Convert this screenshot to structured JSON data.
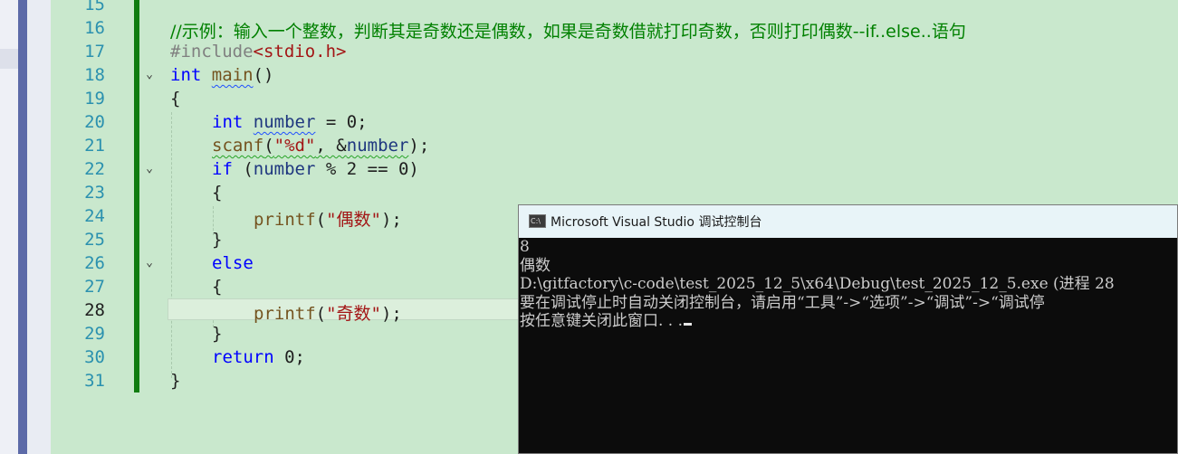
{
  "editor": {
    "lines": [
      {
        "num": "15"
      },
      {
        "num": "16"
      },
      {
        "num": "17"
      },
      {
        "num": "18"
      },
      {
        "num": "19"
      },
      {
        "num": "20"
      },
      {
        "num": "21"
      },
      {
        "num": "22"
      },
      {
        "num": "23"
      },
      {
        "num": "24"
      },
      {
        "num": "25"
      },
      {
        "num": "26"
      },
      {
        "num": "27"
      },
      {
        "num": "28"
      },
      {
        "num": "29"
      },
      {
        "num": "30"
      },
      {
        "num": "31"
      }
    ],
    "code": {
      "comment": "//示例：输入一个整数，判断其是奇数还是偶数，如果是奇数借就打印奇数，否则打印偶数--if..else..语句",
      "include_kw": "#include",
      "include_hdr": "<stdio.h>",
      "int_kw": "int",
      "main_fn": "main",
      "main_parens": "()",
      "open_brace": "{",
      "close_brace": "}",
      "number_var": "number",
      "assign_zero": " = 0;",
      "scanf_fn": "scanf",
      "paren_open": "(",
      "fmt_str": "\"%d\"",
      "comma_amp": ", &",
      "paren_close_semi": ");",
      "if_kw": "if",
      "if_rest": " % 2 == 0)",
      "printf_fn": "printf",
      "even_str": "\"偶数\"",
      "odd_str": "\"奇数\"",
      "else_kw": "else",
      "return_kw": "return",
      "return_rest": " 0;"
    }
  },
  "console": {
    "icon_text": "C:\\",
    "title": "Microsoft Visual Studio 调试控制台",
    "lines": [
      "8",
      "偶数",
      "D:\\gitfactory\\c-code\\test_2025_12_5\\x64\\Debug\\test_2025_12_5.exe (进程 28",
      "要在调试停止时自动关闭控制台，请启用“工具”->“选项”->“调试”->“调试停",
      "按任意键关闭此窗口. . ."
    ]
  }
}
